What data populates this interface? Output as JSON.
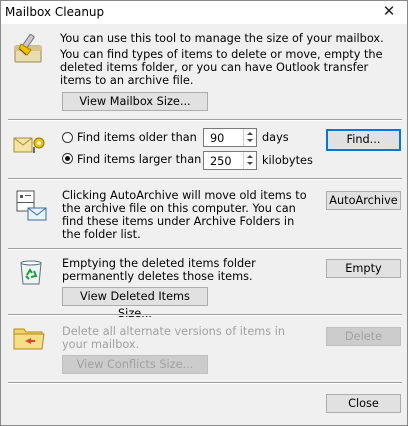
{
  "window": {
    "title": "Mailbox Cleanup",
    "close_glyph": "✕"
  },
  "section_mailbox": {
    "icon": "mailbox-cleanup-brush-icon",
    "line1": "You can use this tool to manage the size of your mailbox.",
    "line2": "You can find types of items to delete or move, empty the deleted items folder, or you can have Outlook transfer items to an archive file.",
    "view_button": "View Mailbox Size..."
  },
  "section_find": {
    "icon": "find-items-key-icon",
    "option_older_label": "Find items older than",
    "older_value": "90",
    "older_unit": "days",
    "option_larger_label": "Find items larger than",
    "larger_value": "250",
    "larger_unit": "kilobytes",
    "selected_option": "larger",
    "find_button": "Find..."
  },
  "section_archive": {
    "icon": "autoarchive-mail-icon",
    "text": "Clicking AutoArchive will move old items to the archive file on this computer. You can find these items under Archive Folders in the folder list.",
    "button": "AutoArchive"
  },
  "section_deleted": {
    "icon": "recycle-bin-icon",
    "text": "Emptying the deleted items folder permanently deletes those items.",
    "empty_button": "Empty",
    "view_button": "View Deleted Items Size..."
  },
  "section_conflicts": {
    "icon": "conflicts-folder-icon",
    "text": "Delete all alternate versions of items in your mailbox.",
    "delete_button": "Delete",
    "view_button": "View Conflicts Size..."
  },
  "footer": {
    "close_button": "Close"
  },
  "colors": {
    "accent": "#0078d7",
    "window_bg": "#f0f0f0",
    "disabled_text": "#a0a0a0"
  }
}
